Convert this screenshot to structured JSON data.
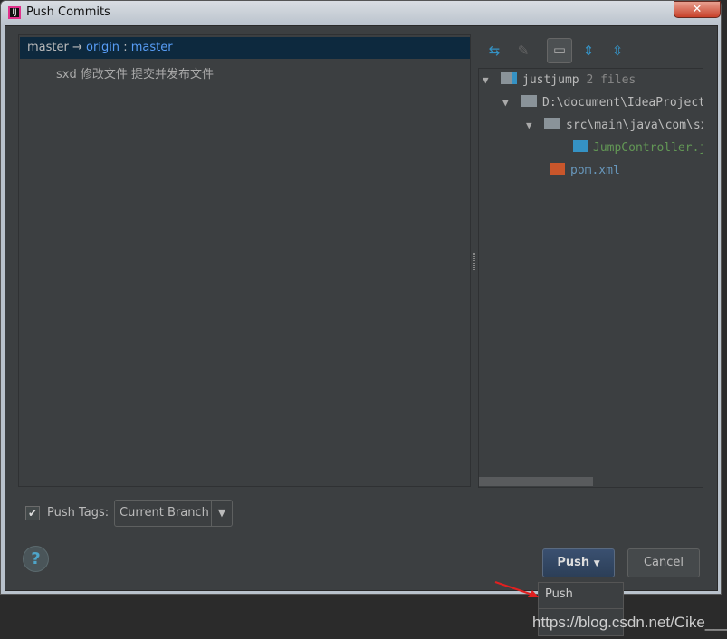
{
  "window": {
    "title": "Push Commits",
    "close": "✕"
  },
  "commits": {
    "local_branch": "master",
    "arrow": "→",
    "remote": "origin",
    "sep": ":",
    "remote_branch": "master",
    "message": "sxd 修改文件 提交并发布文件"
  },
  "tree": {
    "root": "justjump",
    "root_count": "2 files",
    "path": "D:\\document\\IdeaProject",
    "subpath": "src\\main\\java\\com\\sx",
    "file1": "JumpController.java",
    "file2": "pom.xml"
  },
  "bottom": {
    "push_tags_label": "Push Tags:",
    "push_tags_checked": true,
    "tags_value": "Current Branch",
    "help": "?",
    "push": "Push",
    "cancel": "Cancel"
  },
  "menu": {
    "item1": "Push"
  },
  "watermark": "https://blog.csdn.net/Cike___",
  "colors": {
    "accent": "#589df6",
    "selection": "#0d293e",
    "modified_file": "#629755",
    "new_file": "#6897bb"
  }
}
